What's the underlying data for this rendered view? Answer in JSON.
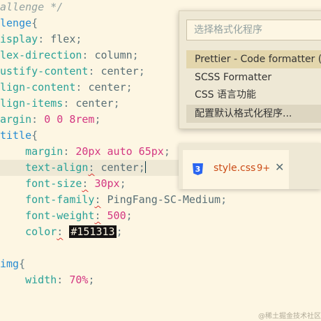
{
  "code": {
    "l1_comment": "allenge */",
    "l2_selector": "lenge",
    "l2_brace": "{",
    "l3_prop": "isplay",
    "l3_val": "flex",
    "l4_prop": "lex-direction",
    "l4_val": "column",
    "l5_prop": "ustify-content",
    "l5_val": "center",
    "l6_prop": "lign-content",
    "l6_val": "center",
    "l7_prop": "lign-items",
    "l7_val": "center",
    "l8_prop": "argin",
    "l8_val": "0 0 8rem",
    "l9_selector": "title",
    "l9_brace": "{",
    "l10_prop": "margin",
    "l10_val": "20px auto 65px",
    "l11_prop": "text-align",
    "l11_val": "center",
    "l12_prop": "font-size",
    "l12_val": "30px",
    "l13_prop": "font-family",
    "l13_val": "PingFang-SC-Medium",
    "l14_prop": "font-weight",
    "l14_val": "500",
    "l15_prop": "color",
    "l15_val": "#151313",
    "l17_selector": "img",
    "l17_brace": "{",
    "l18_prop": "width",
    "l18_val": "70%"
  },
  "quick_pick": {
    "placeholder": "选择格式化程序",
    "items": [
      "Prettier - Code formatter (",
      "SCSS Formatter",
      "CSS 语言功能",
      "配置默认格式化程序..."
    ]
  },
  "tab": {
    "icon_letter": "3",
    "filename": "style.css",
    "badge": "9+",
    "close": "✕"
  },
  "watermark": "@稀土掘金技术社区",
  "colors": {
    "background": "#fdf6e3",
    "highlight_swatch": "#151313",
    "css_icon": "#2965f1",
    "error_squiggle": "#dc322f"
  }
}
